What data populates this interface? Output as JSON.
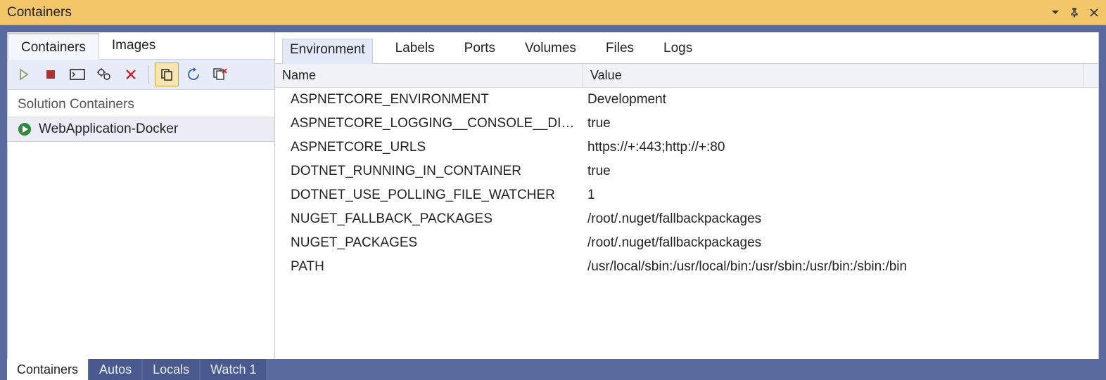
{
  "title": "Containers",
  "left": {
    "tabs": [
      "Containers",
      "Images"
    ],
    "active_tab": 0,
    "section_label": "Solution Containers",
    "items": [
      {
        "name": "WebApplication-Docker"
      }
    ]
  },
  "detail": {
    "tabs": [
      "Environment",
      "Labels",
      "Ports",
      "Volumes",
      "Files",
      "Logs"
    ],
    "active_tab": 0,
    "columns": [
      "Name",
      "Value"
    ],
    "rows": [
      {
        "name": "ASPNETCORE_ENVIRONMENT",
        "value": "Development"
      },
      {
        "name": "ASPNETCORE_LOGGING__CONSOLE__DISABLECOLORS",
        "value": "true"
      },
      {
        "name": "ASPNETCORE_URLS",
        "value": "https://+:443;http://+:80"
      },
      {
        "name": "DOTNET_RUNNING_IN_CONTAINER",
        "value": "true"
      },
      {
        "name": "DOTNET_USE_POLLING_FILE_WATCHER",
        "value": "1"
      },
      {
        "name": "NUGET_FALLBACK_PACKAGES",
        "value": "/root/.nuget/fallbackpackages"
      },
      {
        "name": "NUGET_PACKAGES",
        "value": "/root/.nuget/fallbackpackages"
      },
      {
        "name": "PATH",
        "value": "/usr/local/sbin:/usr/local/bin:/usr/sbin:/usr/bin:/sbin:/bin"
      }
    ]
  },
  "bottom_tabs": [
    "Containers",
    "Autos",
    "Locals",
    "Watch 1"
  ],
  "bottom_active": 0
}
